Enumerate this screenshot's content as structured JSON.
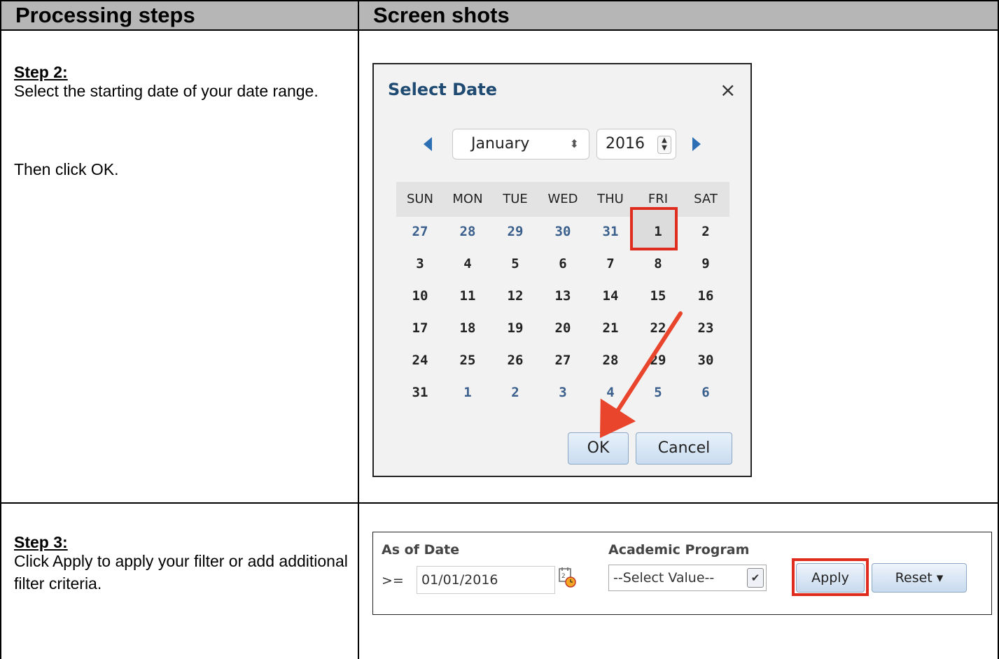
{
  "headers": {
    "left": "Processing steps",
    "right": "Screen shots"
  },
  "step2": {
    "title": "Step 2:",
    "line1": "Select the starting date of your date range.",
    "line2": "Then click OK."
  },
  "step3": {
    "title": "Step 3:",
    "text": "Click Apply to apply your filter or add additional filter criteria."
  },
  "date_dialog": {
    "title": "Select Date",
    "close_glyph": "×",
    "month": "January",
    "year": "2016",
    "weekdays": [
      "SUN",
      "MON",
      "TUE",
      "WED",
      "THU",
      "FRI",
      "SAT"
    ],
    "weeks": [
      [
        "27",
        "28",
        "29",
        "30",
        "31",
        "1",
        "2"
      ],
      [
        "3",
        "4",
        "5",
        "6",
        "7",
        "8",
        "9"
      ],
      [
        "10",
        "11",
        "12",
        "13",
        "14",
        "15",
        "16"
      ],
      [
        "17",
        "18",
        "19",
        "20",
        "21",
        "22",
        "23"
      ],
      [
        "24",
        "25",
        "26",
        "27",
        "28",
        "29",
        "30"
      ],
      [
        "31",
        "1",
        "2",
        "3",
        "4",
        "5",
        "6"
      ]
    ],
    "selected_day": "1",
    "ok_label": "OK",
    "cancel_label": "Cancel",
    "highlight_color": "#e02c1e"
  },
  "filter_panel": {
    "date_label": "As of Date",
    "operator": ">=",
    "date_value": "01/01/2016",
    "program_label": "Academic Program",
    "program_value": "--Select Value--",
    "apply_label": "Apply",
    "reset_label": "Reset"
  }
}
